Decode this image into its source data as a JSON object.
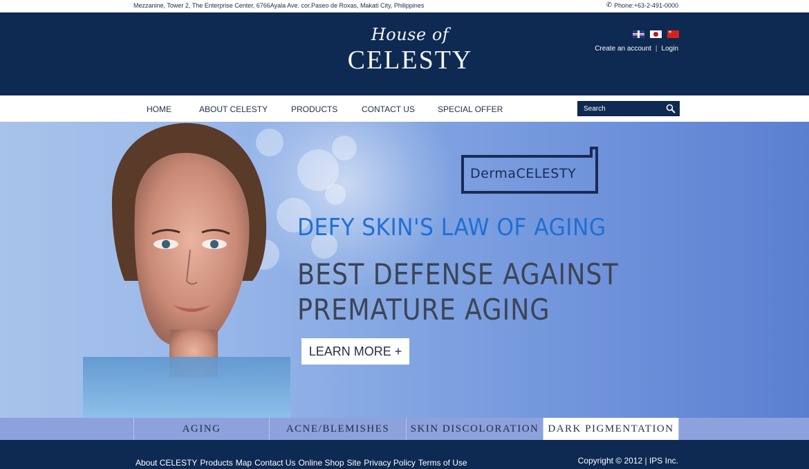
{
  "topbar": {
    "address": "Mezzanine, Tower 2, The Enterprise Center, 6766Ayala Ave. cor.Paseo de Roxas, Makati City, Philippines",
    "phone": "Phone:+63-2-491-0000"
  },
  "header": {
    "logo_script": "House of",
    "logo_brand": "CELESTY",
    "languages": [
      "uk-flag-icon",
      "japan-flag-icon",
      "china-flag-icon"
    ],
    "create_account": "Create an account",
    "separator": "|",
    "login": "Login"
  },
  "nav": {
    "items": [
      "HOME",
      "ABOUT CELESTY",
      "PRODUCTS",
      "CONTACT US",
      "SPECIAL OFFER"
    ],
    "search_placeholder": "Search"
  },
  "hero": {
    "product_logo": "DermaCELESTY",
    "headline": "DEFY SKIN'S LAW OF AGING",
    "subheadline_line1": "BEST DEFENSE AGAINST",
    "subheadline_line2": "PREMATURE AGING",
    "cta": "LEARN MORE +"
  },
  "tabs": {
    "items": [
      "AGING",
      "ACNE/BLEMISHES",
      "SKIN DISCOLORATION",
      "DARK PIGMENTATION"
    ],
    "active_index": 3
  },
  "footer": {
    "links": [
      "About CELESTY",
      "Products",
      "Map",
      "Contact Us",
      "Online Shop",
      "Site",
      "Privacy Policy",
      "Terms of Use"
    ],
    "copyright": "Copyright © 2012 | IPS Inc."
  },
  "colors": {
    "navy": "#0e2a52",
    "headline_blue": "#1f6fd6",
    "tab_strip": "#8da2dc"
  }
}
